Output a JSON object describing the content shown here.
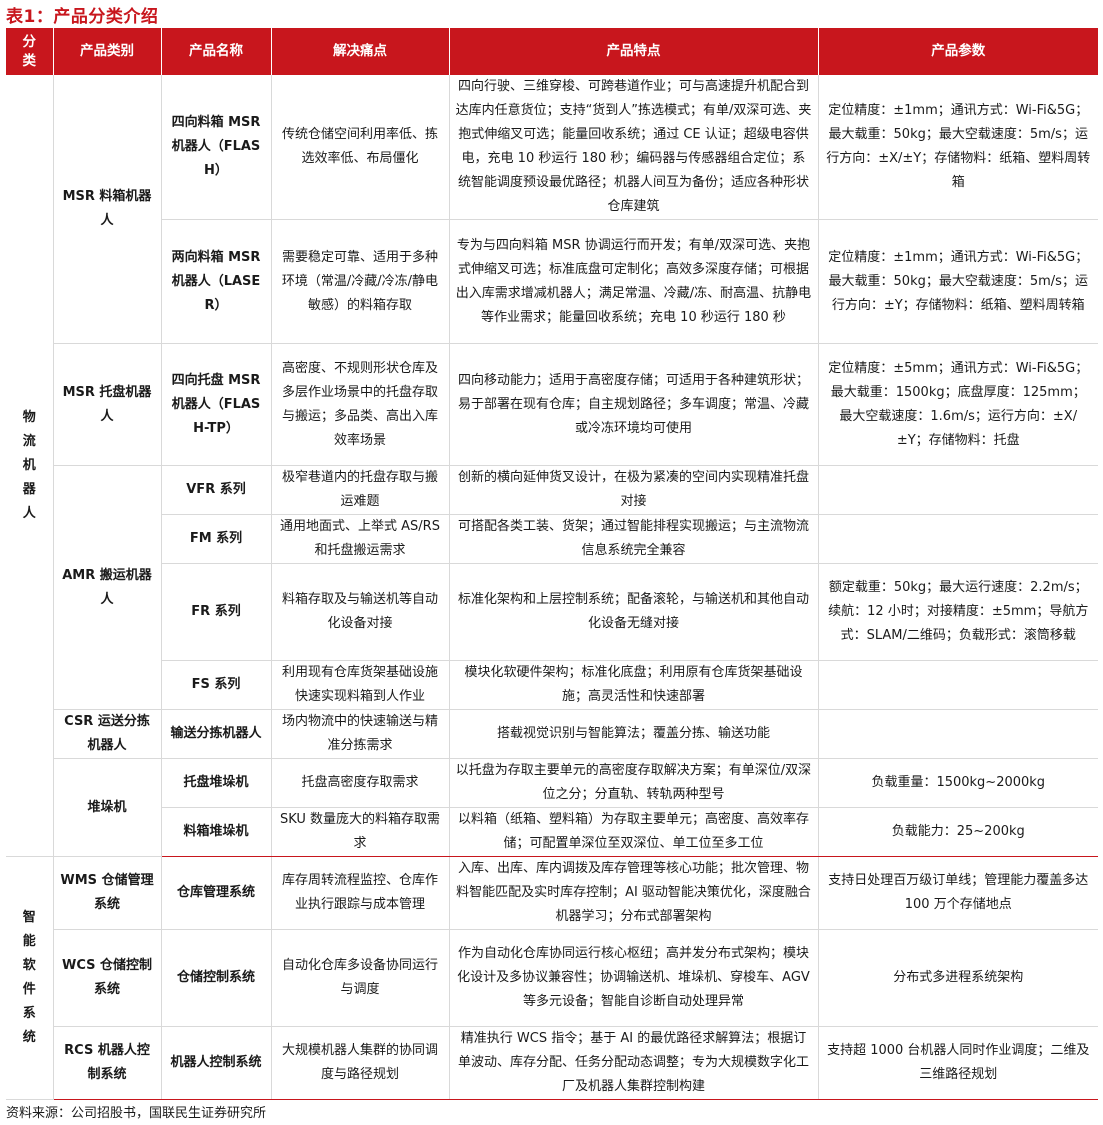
{
  "title": "表1：产品分类介绍",
  "source": "资料来源：公司招股书，国联民生证券研究所",
  "colors": {
    "accent": "#c8161d",
    "grid": "#d9d9d9"
  },
  "headers": {
    "c0": "分\n类",
    "c1": "产品类别",
    "c2": "产品名称",
    "c3": "解决痛点",
    "c4": "产品特点",
    "c5": "产品参数"
  },
  "groups": {
    "g1": "物\n流\n机\n器\n人",
    "g2": "智\n能\n软\n件\n系\n统"
  },
  "categories": {
    "msr_box": "MSR 料箱机器人",
    "msr_pallet": "MSR 托盘机器人",
    "amr": "AMR 搬运机器人",
    "csr": "CSR 运送分拣机器人",
    "stacker": "堆垛机",
    "wms": "WMS 仓储管理系统",
    "wcs": "WCS 仓储控制系统",
    "rcs": "RCS 机器人控制系统"
  },
  "rows": [
    {
      "name": "四向料箱 MSR 机器人（FLASH）",
      "pain": "传统仓储空间利用率低、拣选效率低、布局僵化",
      "feature": "四向行驶、三维穿梭、可跨巷道作业；可与高速提升机配合到达库内任意货位；支持“货到人”拣选模式；有单/双深可选、夹抱式伸缩叉可选；能量回收系统；通过 CE 认证；超级电容供电，充电 10 秒运行 180 秒；编码器与传感器组合定位；系统智能调度预设最优路径；机器人间互为备份；适应各种形状仓库建筑",
      "param": "定位精度：±1mm；通讯方式：Wi-Fi&5G；最大载重：50kg；最大空载速度：5m/s；运行方向：±X/±Y；存储物料：纸箱、塑料周转箱"
    },
    {
      "name": "两向料箱 MSR 机器人（LASER）",
      "pain": "需要稳定可靠、适用于多种环境（常温/冷藏/冷冻/静电敏感）的料箱存取",
      "feature": "专为与四向料箱 MSR 协调运行而开发；有单/双深可选、夹抱式伸缩叉可选；标准底盘可定制化；高效多深度存储；可根据出入库需求增减机器人；满足常温、冷藏/冻、耐高温、抗静电等作业需求；能量回收系统；充电 10 秒运行 180 秒",
      "param": "定位精度：±1mm；通讯方式：Wi-Fi&5G；最大载重：50kg；最大空载速度：5m/s；运行方向：±Y；存储物料：纸箱、塑料周转箱"
    },
    {
      "name": "四向托盘 MSR 机器人（FLASH-TP）",
      "pain": "高密度、不规则形状仓库及多层作业场景中的托盘存取与搬运；多品类、高出入库效率场景",
      "feature": "四向移动能力；适用于高密度存储；可适用于各种建筑形状；易于部署在现有仓库；自主规划路径；多车调度；常温、冷藏或冷冻环境均可使用",
      "param": "定位精度：±5mm；通讯方式：Wi-Fi&5G；最大载重：1500kg；底盘厚度：125mm；最大空载速度：1.6m/s；运行方向：±X/±Y；存储物料：托盘"
    },
    {
      "name": "VFR 系列",
      "pain": "极窄巷道内的托盘存取与搬运难题",
      "feature": "创新的横向延伸货叉设计，在极为紧凑的空间内实现精准托盘对接",
      "param": ""
    },
    {
      "name": "FM 系列",
      "pain": "通用地面式、上举式 AS/RS 和托盘搬运需求",
      "feature": "可搭配各类工装、货架；通过智能排程实现搬运；与主流物流信息系统完全兼容",
      "param": ""
    },
    {
      "name": "FR 系列",
      "pain": "料箱存取及与输送机等自动化设备对接",
      "feature": "标准化架构和上层控制系统；配备滚轮，与输送机和其他自动化设备无缝对接",
      "param": "额定载重：50kg；最大运行速度：2.2m/s；续航：12 小时；对接精度：±5mm；导航方式：SLAM/二维码；负载形式：滚筒移载"
    },
    {
      "name": "FS 系列",
      "pain": "利用现有仓库货架基础设施快速实现料箱到人作业",
      "feature": "模块化软硬件架构；标准化底盘；利用原有仓库货架基础设施；高灵活性和快速部署",
      "param": ""
    },
    {
      "name": "输送分拣机器人",
      "pain": "场内物流中的快速输送与精准分拣需求",
      "feature": "搭载视觉识别与智能算法；覆盖分拣、输送功能",
      "param": ""
    },
    {
      "name": "托盘堆垛机",
      "pain": "托盘高密度存取需求",
      "feature": "以托盘为存取主要单元的高密度存取解决方案；有单深位/双深位之分；分直轨、转轨两种型号",
      "param": "负载重量：1500kg~2000kg"
    },
    {
      "name": "料箱堆垛机",
      "pain": "SKU 数量庞大的料箱存取需求",
      "feature": "以料箱（纸箱、塑料箱）为存取主要单元；高密度、高效率存储；可配置单深位至双深位、单工位至多工位",
      "param": "负载能力：25~200kg"
    },
    {
      "name": "仓库管理系统",
      "pain": "库存周转流程监控、仓库作业执行跟踪与成本管理",
      "feature": "入库、出库、库内调拨及库存管理等核心功能；批次管理、物料智能匹配及实时库存控制；AI 驱动智能决策优化，深度融合机器学习；分布式部署架构",
      "param": "支持日处理百万级订单线；管理能力覆盖多达 100 万个存储地点"
    },
    {
      "name": "仓储控制系统",
      "pain": "自动化仓库多设备协同运行与调度",
      "feature": "作为自动化仓库协同运行核心枢纽；高并发分布式架构；模块化设计及多协议兼容性；协调输送机、堆垛机、穿梭车、AGV 等多元设备；智能自诊断自动处理异常",
      "param": "分布式多进程系统架构"
    },
    {
      "name": "机器人控制系统",
      "pain": "大规模机器人集群的协同调度与路径规划",
      "feature": "精准执行 WCS 指令；基于 AI 的最优路径求解算法；根据订单波动、库存分配、任务分配动态调整；专为大规模数字化工厂及机器人集群控制构建",
      "param": "支持超 1000 台机器人同时作业调度；二维及三维路径规划"
    }
  ]
}
